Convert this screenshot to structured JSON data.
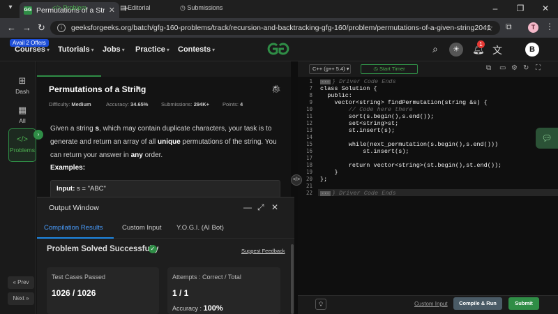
{
  "browser": {
    "tab_title": "Permutations of a String | Practice",
    "url": "geeksforgeeks.org/batch/gfg-160-problems/track/recursion-and-backtracking-gfg-160/problem/permutations-of-a-given-string2041",
    "profile_initial": "T"
  },
  "header": {
    "offer_badge": "Avail 2 Offers",
    "menu": [
      "Courses",
      "Tutorials",
      "Jobs",
      "Practice",
      "Contests"
    ],
    "notification_count": "1",
    "user_initial": "B"
  },
  "sidebar": {
    "items": [
      "Dash",
      "All",
      "Problems"
    ],
    "prev_label": "« Prev",
    "next_label": "Next »"
  },
  "problem": {
    "tabs": [
      "Problem",
      "Editorial",
      "Submissions"
    ],
    "title": "Permutations of a String",
    "difficulty_label": "Difficulty:",
    "difficulty": "Medium",
    "accuracy_label": "Accuracy:",
    "accuracy": "34.65%",
    "submissions_label": "Submissions:",
    "submissions": "294K+",
    "points_label": "Points:",
    "points": "4",
    "desc_1": "Given a string ",
    "desc_s": "s",
    "desc_2": ", which may contain duplicate characters, your task is to generate and return an array of all ",
    "desc_unique": "unique",
    "desc_3": " permutations of the string. You can return your answer in ",
    "desc_any": "any",
    "desc_4": " order.",
    "examples_label": "Examples:",
    "example_input_label": "Input:",
    "example_input": "s = \"ABC\""
  },
  "output": {
    "title": "Output Window",
    "tabs": [
      "Compilation Results",
      "Custom Input",
      "Y.O.G.I. (AI Bot)"
    ],
    "status": "Problem Solved Successfully",
    "feedback": "Suggest Feedback",
    "test_cases_label": "Test Cases Passed",
    "test_cases_value": "1026 / 1026",
    "attempts_label": "Attempts : Correct / Total",
    "attempts_value": "1 / 1",
    "accuracy_label": "Accuracy :",
    "accuracy_value": "100%"
  },
  "editor": {
    "language": "C++ (g++ 5.4)",
    "timer_label": "Start Timer",
    "fold_marker": "···",
    "lines": [
      {
        "n": "1",
        "text": "} Driver Code Ends",
        "comment": true,
        "fold": true
      },
      {
        "n": "7",
        "text": "class Solution {",
        "comment": false
      },
      {
        "n": "8",
        "text": "  public:",
        "comment": false
      },
      {
        "n": "9",
        "text": "    vector<string> findPermutation(string &s) {",
        "comment": false
      },
      {
        "n": "10",
        "text": "        // Code here there",
        "comment": true
      },
      {
        "n": "11",
        "text": "        sort(s.begin(),s.end());",
        "comment": false
      },
      {
        "n": "12",
        "text": "        set<string>st;",
        "comment": false
      },
      {
        "n": "13",
        "text": "        st.insert(s);",
        "comment": false
      },
      {
        "n": "14",
        "text": "",
        "comment": false
      },
      {
        "n": "15",
        "text": "        while(next_permutation(s.begin(),s.end()))",
        "comment": false
      },
      {
        "n": "16",
        "text": "            st.insert(s);",
        "comment": false
      },
      {
        "n": "17",
        "text": "",
        "comment": false
      },
      {
        "n": "18",
        "text": "        return vector<string>(st.begin(),st.end());",
        "comment": false
      },
      {
        "n": "19",
        "text": "    }",
        "comment": false
      },
      {
        "n": "20",
        "text": "};",
        "comment": false
      },
      {
        "n": "21",
        "text": "",
        "comment": false
      },
      {
        "n": "22",
        "text": "} Driver Code Ends",
        "comment": true,
        "fold": true
      }
    ],
    "custom_input": "Custom Input",
    "compile_label": "Compile & Run",
    "submit_label": "Submit"
  },
  "colors": {
    "accent_green": "#2f8d46",
    "accent_blue": "#1e88e5",
    "badge_red": "#e53935"
  },
  "icons": [
    "search-icon",
    "theme-toggle-icon",
    "bell-icon",
    "translate-icon",
    "bookmark-icon",
    "bug-icon",
    "check-circle-icon",
    "lightbulb-icon",
    "chat-icon"
  ]
}
